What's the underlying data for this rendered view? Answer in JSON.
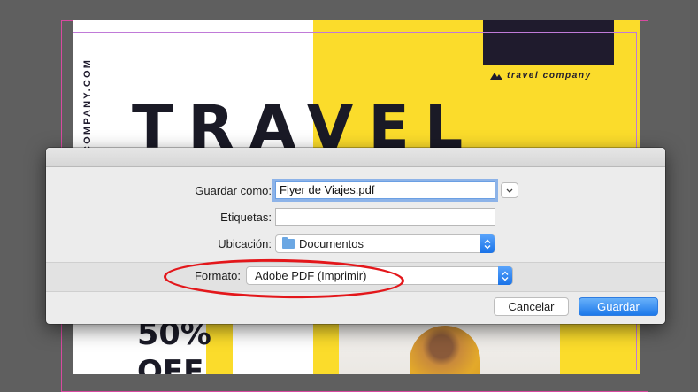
{
  "flyer": {
    "title": "TRAVEL",
    "vertical_text": "COMPANY.COM",
    "logo_text": "travel company",
    "discount_line1": "50%",
    "discount_line2": "OFF"
  },
  "dialog": {
    "save_as_label": "Guardar como:",
    "save_as_value": "Flyer de Viajes.pdf",
    "tags_label": "Etiquetas:",
    "tags_value": "",
    "location_label": "Ubicación:",
    "location_value": "Documentos",
    "format_label": "Formato:",
    "format_value": "Adobe PDF (Imprimir)",
    "cancel_label": "Cancelar",
    "save_label": "Guardar"
  },
  "colors": {
    "flyer_yellow": "#fbdc2b",
    "flyer_dark": "#1f1b2d",
    "primary_button": "#1d79ea",
    "highlight_ellipse": "#e3171b"
  }
}
